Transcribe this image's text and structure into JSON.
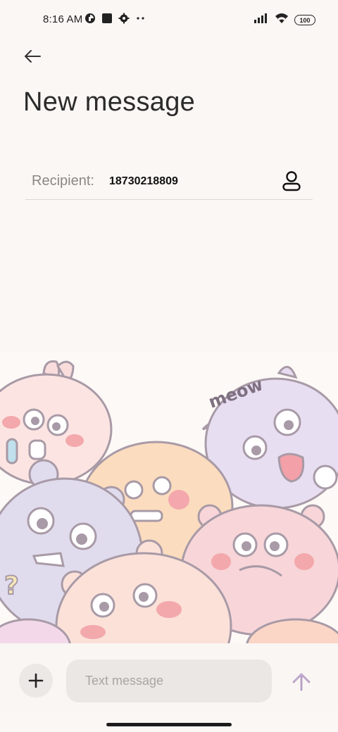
{
  "status_bar": {
    "time": "8:16 AM",
    "battery": "100",
    "icons": [
      "data-saver-icon",
      "square-app-icon",
      "settings-gear-icon",
      "more-dots-icon",
      "signal-icon",
      "wifi-icon",
      "battery-icon"
    ]
  },
  "header": {
    "back_icon": "arrow-left-icon",
    "title": "New message"
  },
  "recipient": {
    "label": "Recipient:",
    "value": "18730218809",
    "contact_icon": "person-icon"
  },
  "wallpaper": {
    "text": "meow"
  },
  "composer": {
    "add_icon": "plus-icon",
    "placeholder": "Text message",
    "send_icon": "arrow-up-send-icon",
    "send_color": "#9b7fb0"
  }
}
